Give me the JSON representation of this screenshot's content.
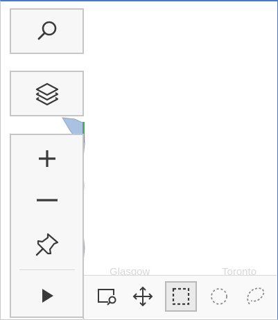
{
  "map": {
    "background_labels": [
      "Glasgow",
      "Toronto"
    ]
  },
  "toolbar": {
    "search": {
      "icon": "search-icon"
    },
    "layers": {
      "icon": "layers-icon"
    },
    "zoom_in": {
      "icon": "plus-icon"
    },
    "zoom_out": {
      "icon": "minus-icon"
    },
    "pin": {
      "icon": "pushpin-icon"
    },
    "play": {
      "icon": "play-icon"
    }
  },
  "selection_bar": {
    "tools": [
      {
        "name": "zoom-to-area",
        "icon": "zoom-rect-icon"
      },
      {
        "name": "pan",
        "icon": "move-arrows-icon"
      },
      {
        "name": "rectangle-select",
        "icon": "rect-select-icon",
        "active": true
      },
      {
        "name": "circle-select",
        "icon": "circle-select-icon"
      },
      {
        "name": "lasso-select",
        "icon": "lasso-icon"
      }
    ]
  },
  "colors": {
    "accent_border": "#4a78c2",
    "icon": "#3a3a3a",
    "map_water": "#a9c2e1",
    "map_land_green": "#4caf50"
  }
}
